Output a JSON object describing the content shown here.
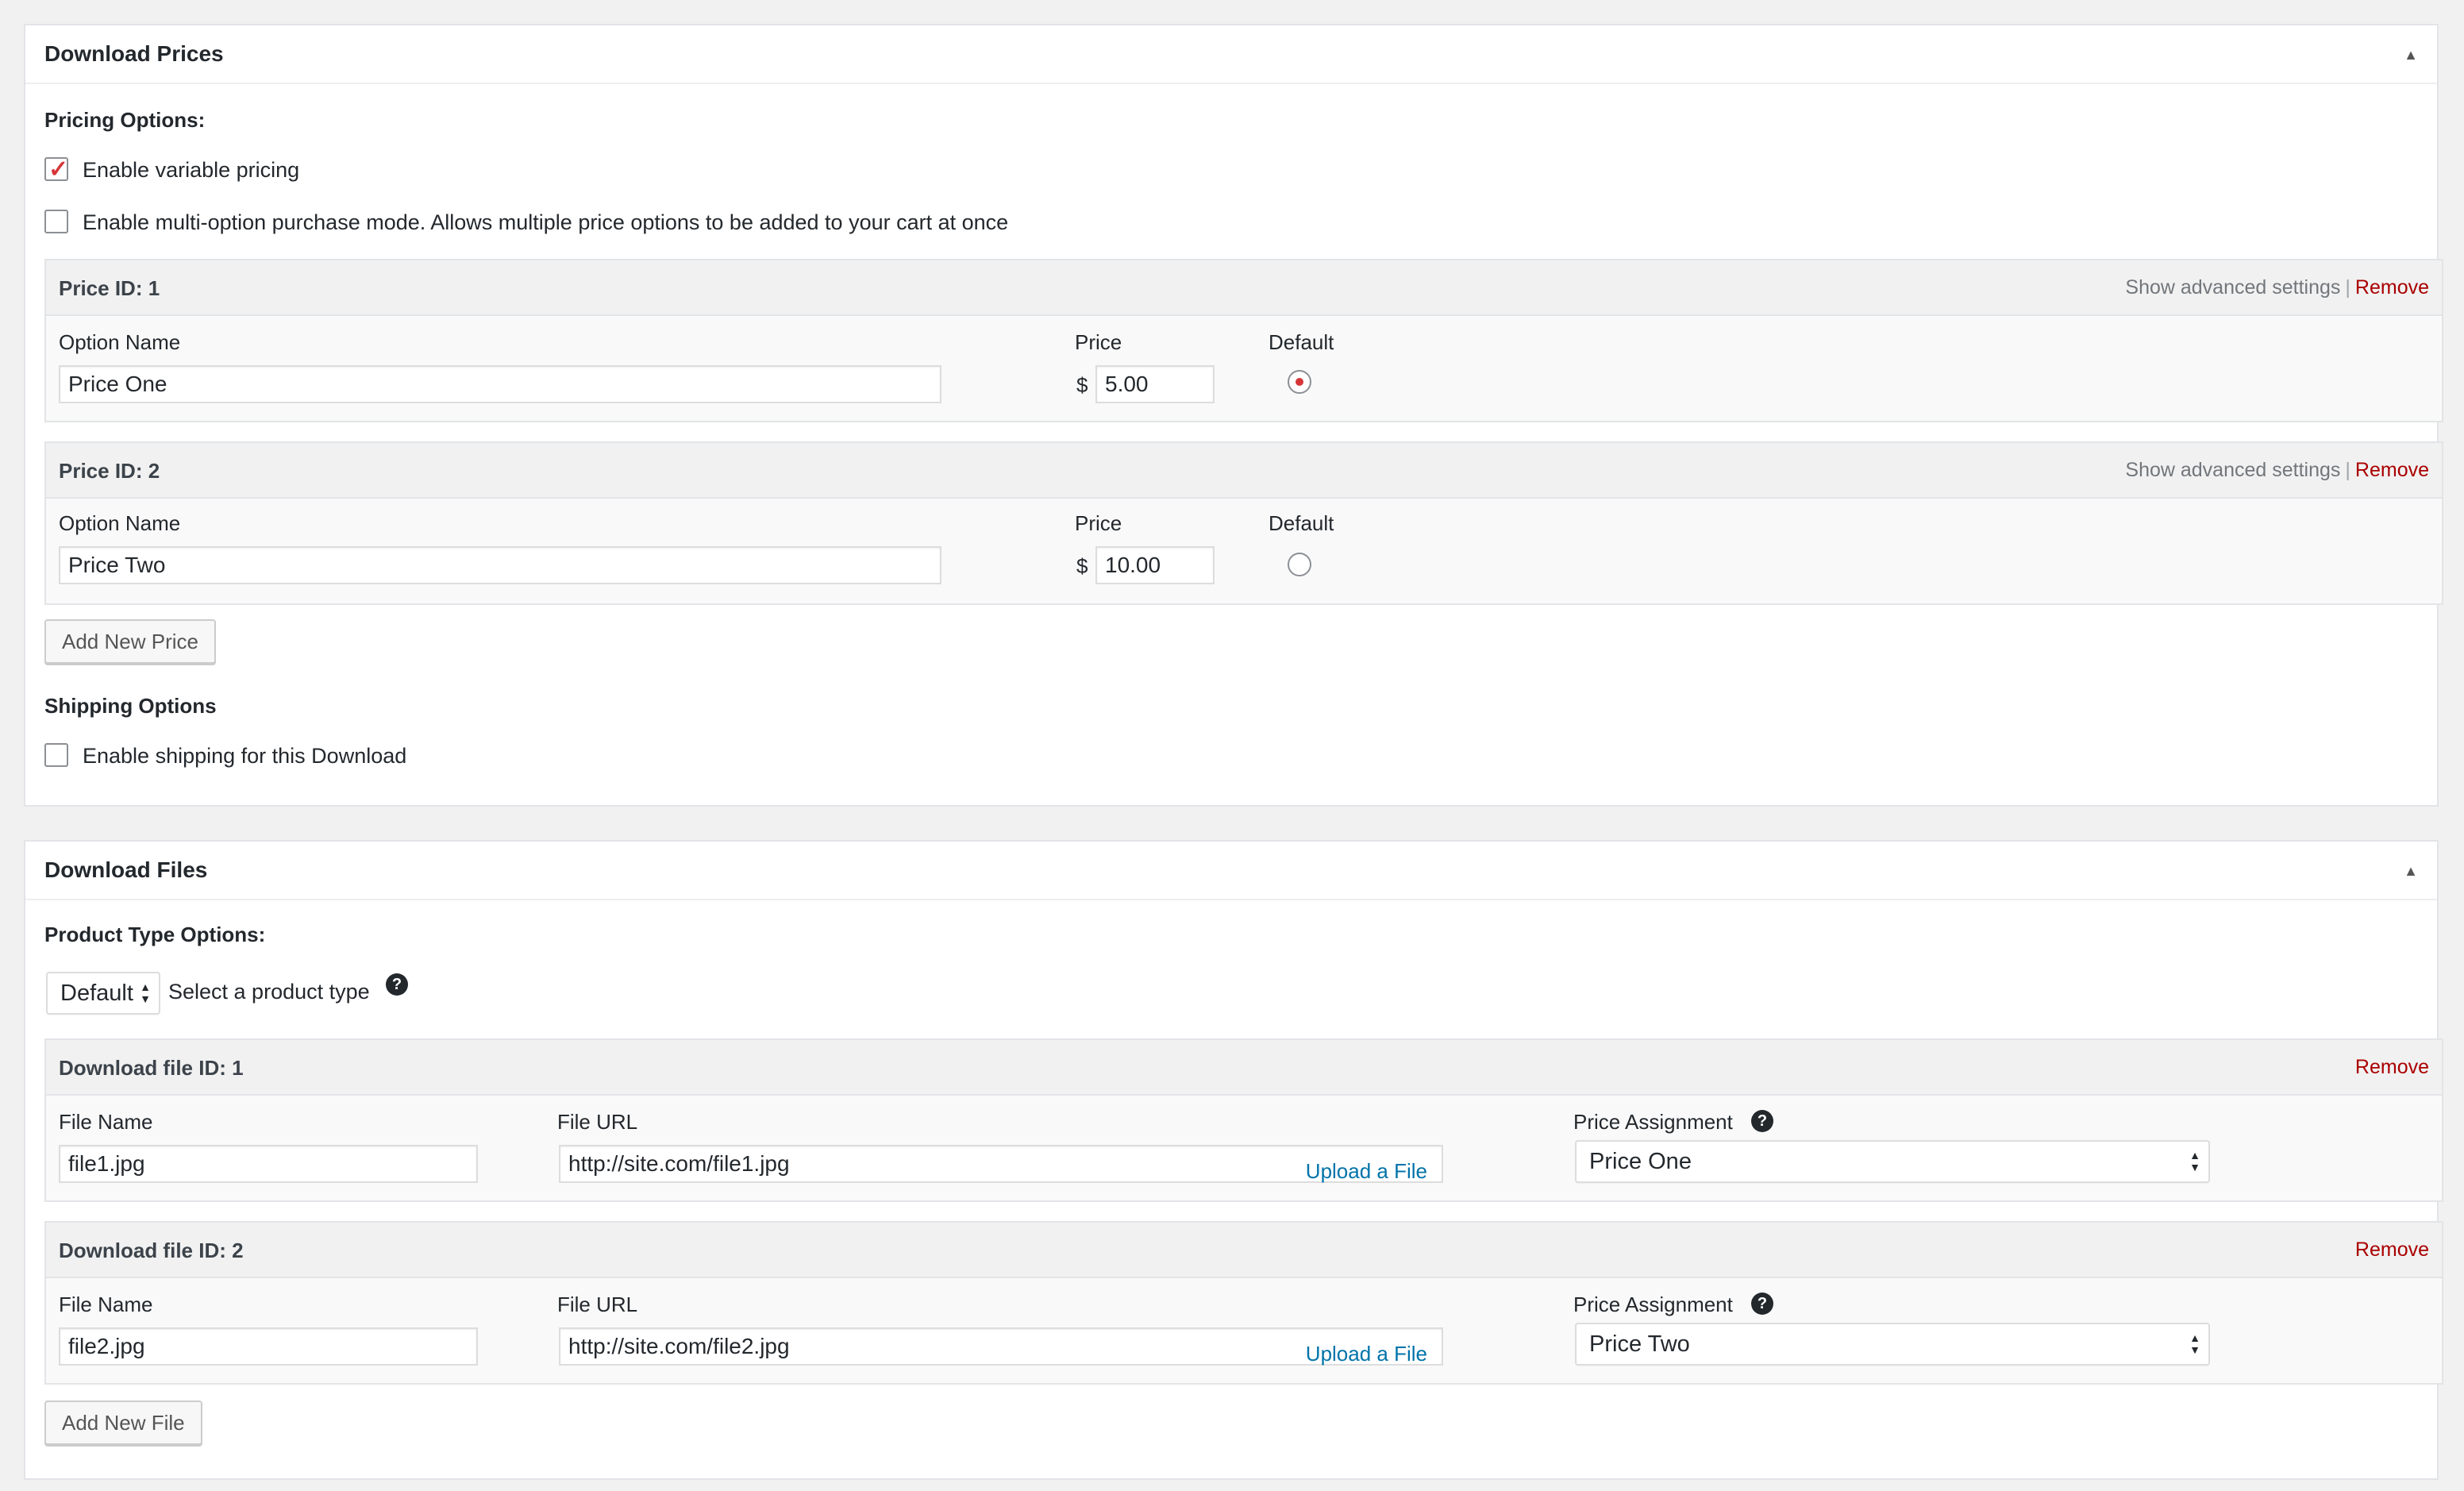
{
  "prices_panel": {
    "title": "Download Prices",
    "pricing_options_label": "Pricing Options:",
    "variable_pricing_label": "Enable variable pricing",
    "variable_pricing_checked": true,
    "multi_option_label": "Enable multi-option purchase mode. Allows multiple price options to be added to your cart at once",
    "multi_option_checked": false,
    "advanced_link": "Show advanced settings",
    "separator": "|",
    "remove_label": "Remove",
    "option_name_label": "Option Name",
    "price_label": "Price",
    "default_label": "Default",
    "currency_symbol": "$",
    "prices": [
      {
        "title": "Price ID: 1",
        "name": "Price One",
        "amount": "5.00",
        "default": true
      },
      {
        "title": "Price ID: 2",
        "name": "Price Two",
        "amount": "10.00",
        "default": false
      }
    ],
    "add_price_button": "Add New Price",
    "shipping_label": "Shipping Options",
    "shipping_checkbox_label": "Enable shipping for this Download",
    "shipping_checked": false
  },
  "files_panel": {
    "title": "Download Files",
    "product_type_label": "Product Type Options:",
    "product_type_value": "Default",
    "product_type_hint": "Select a product type",
    "help_icon": "question-mark",
    "remove_label": "Remove",
    "file_name_label": "File Name",
    "file_url_label": "File URL",
    "price_assignment_label": "Price Assignment",
    "upload_label": "Upload a File",
    "files": [
      {
        "title": "Download file ID: 1",
        "name": "file1.jpg",
        "url": "http://site.com/file1.jpg",
        "price": "Price One"
      },
      {
        "title": "Download file ID: 2",
        "name": "file2.jpg",
        "url": "http://site.com/file2.jpg",
        "price": "Price Two"
      }
    ],
    "add_file_button": "Add New File"
  },
  "colors": {
    "accent_red": "#d63638",
    "remove_red": "#aa0000",
    "link_blue": "#0073aa",
    "background": "#f1f1f1"
  }
}
